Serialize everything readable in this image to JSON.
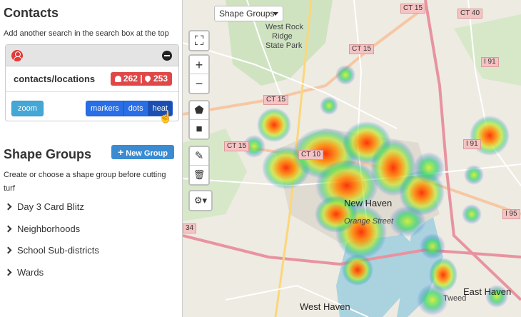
{
  "contacts": {
    "title": "Contacts",
    "hint": "Add another search in the search box at the top",
    "dataset_label": "contacts/locations",
    "badge_contacts": "262",
    "badge_sep": "|",
    "badge_locations": "253",
    "zoom_label": "zoom",
    "modes": [
      "markers",
      "dots",
      "heat"
    ],
    "active_mode": "heat"
  },
  "shape_groups": {
    "title": "Shape Groups",
    "new_group_label": "New Group",
    "hint": "Create or choose a shape group before cutting turf",
    "items": [
      "Day 3 Card Blitz",
      "Neighborhoods",
      "School Sub-districts",
      "Wards"
    ]
  },
  "map": {
    "dropdown_label": "Shape Groups",
    "shields": [
      "CT 15",
      "CT 40",
      "CT 15",
      "CT 15",
      "CT 15",
      "CT 10",
      "I 91",
      "I 91",
      "I 95",
      "34"
    ],
    "labels": {
      "west_rock": "West Rock",
      "ridge": "Ridge",
      "state_park": "State Park",
      "new_haven": "New Haven",
      "orange_street": "Orange Street",
      "west_haven": "West Haven",
      "east_haven": "East Haven",
      "tweed": "Tweed"
    },
    "controls": {
      "fit": "⛶",
      "zoom_in": "+",
      "zoom_out": "−",
      "polygon": "⬟",
      "square": "■",
      "edit": "✎",
      "trash": "🗑",
      "settings": "⚙▾"
    }
  }
}
